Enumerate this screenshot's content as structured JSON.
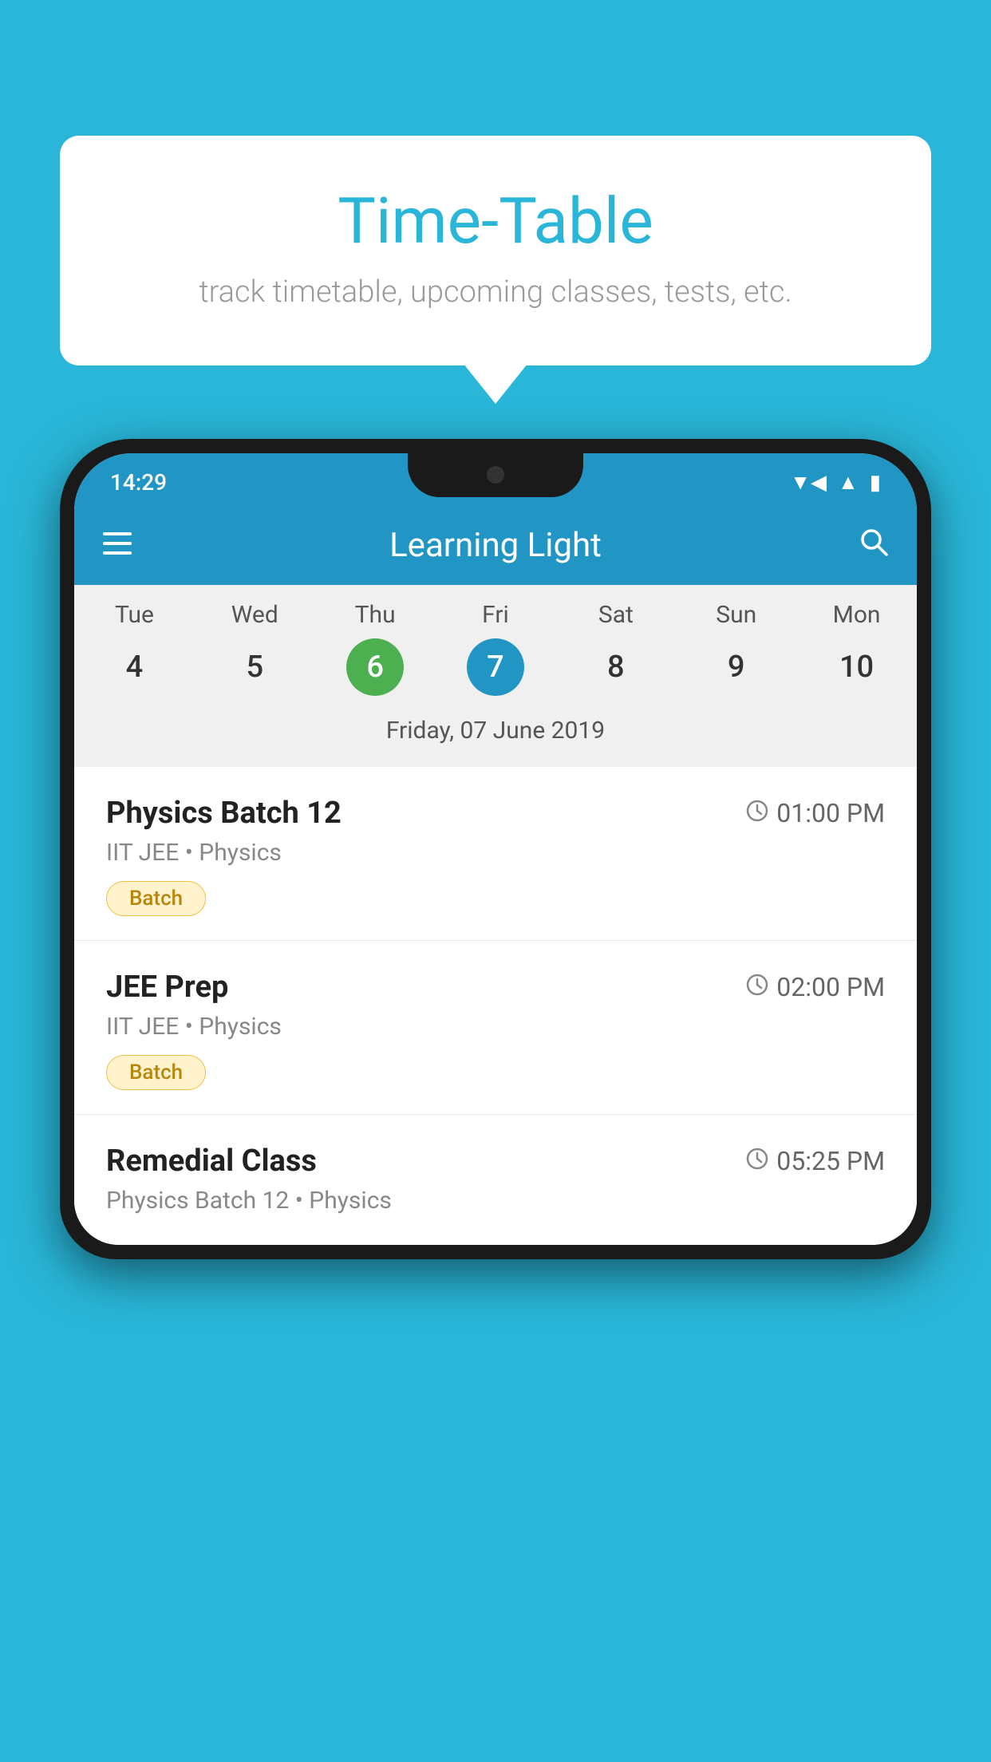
{
  "background_color": "#29B6D8",
  "tooltip": {
    "title": "Time-Table",
    "subtitle": "track timetable, upcoming classes, tests, etc."
  },
  "phone": {
    "status_bar": {
      "time": "14:29",
      "icons": [
        "wifi",
        "signal",
        "battery"
      ]
    },
    "app_bar": {
      "title": "Learning Light",
      "menu_icon": "☰",
      "search_icon": "🔍"
    },
    "calendar": {
      "days": [
        "Tue",
        "Wed",
        "Thu",
        "Fri",
        "Sat",
        "Sun",
        "Mon"
      ],
      "dates": [
        "4",
        "5",
        "6",
        "7",
        "8",
        "9",
        "10"
      ],
      "today_index": 2,
      "selected_index": 3,
      "selected_date_label": "Friday, 07 June 2019"
    },
    "classes": [
      {
        "name": "Physics Batch 12",
        "time": "01:00 PM",
        "meta": "IIT JEE • Physics",
        "badge": "Batch"
      },
      {
        "name": "JEE Prep",
        "time": "02:00 PM",
        "meta": "IIT JEE • Physics",
        "badge": "Batch"
      },
      {
        "name": "Remedial Class",
        "time": "05:25 PM",
        "meta": "Physics Batch 12 • Physics",
        "badge": null
      }
    ]
  }
}
